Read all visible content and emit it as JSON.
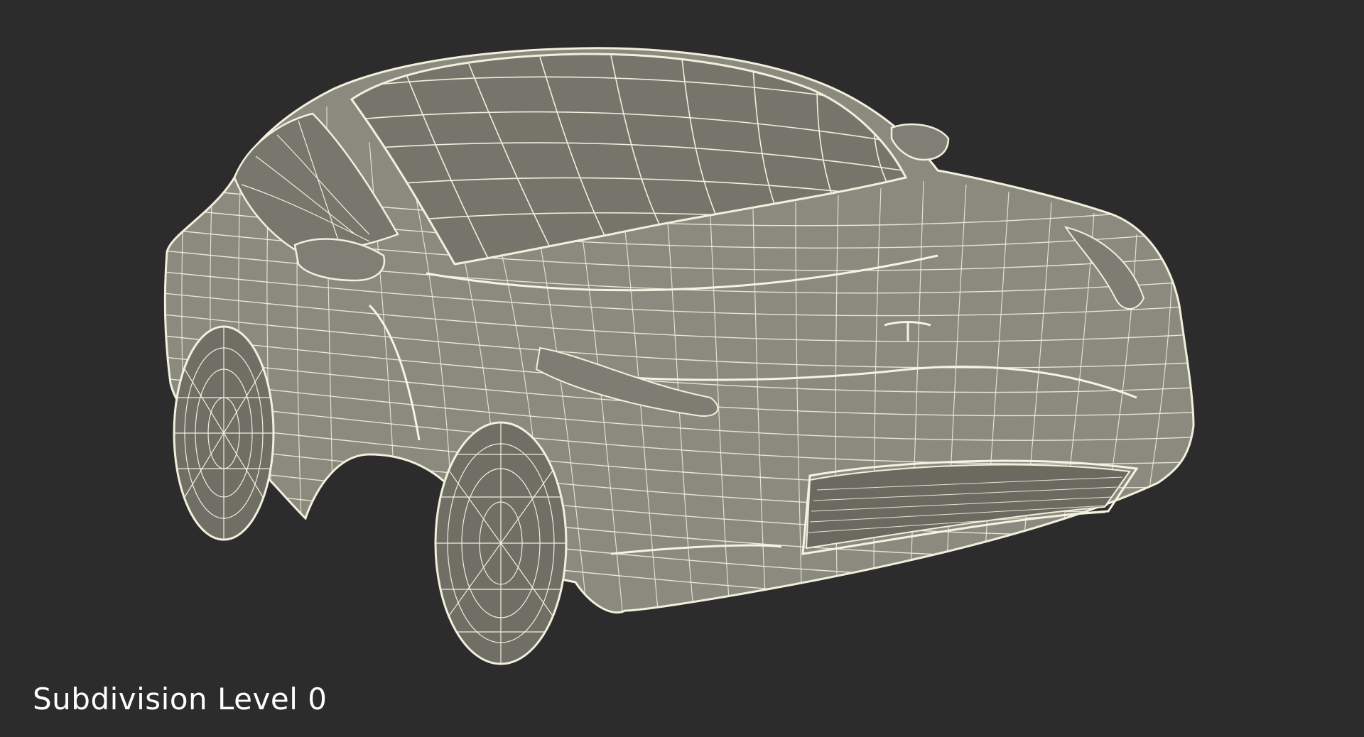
{
  "caption": {
    "text": "Subdivision Level 0"
  },
  "model": {
    "subject": "car-wireframe",
    "wire_color": "#f2efdc",
    "shell_color": "#8c8c80",
    "glass_color": "#75756b",
    "tire_color": "#6f6f66"
  },
  "colors": {
    "background": "#2c2c2c",
    "caption_text": "#ffffff"
  }
}
